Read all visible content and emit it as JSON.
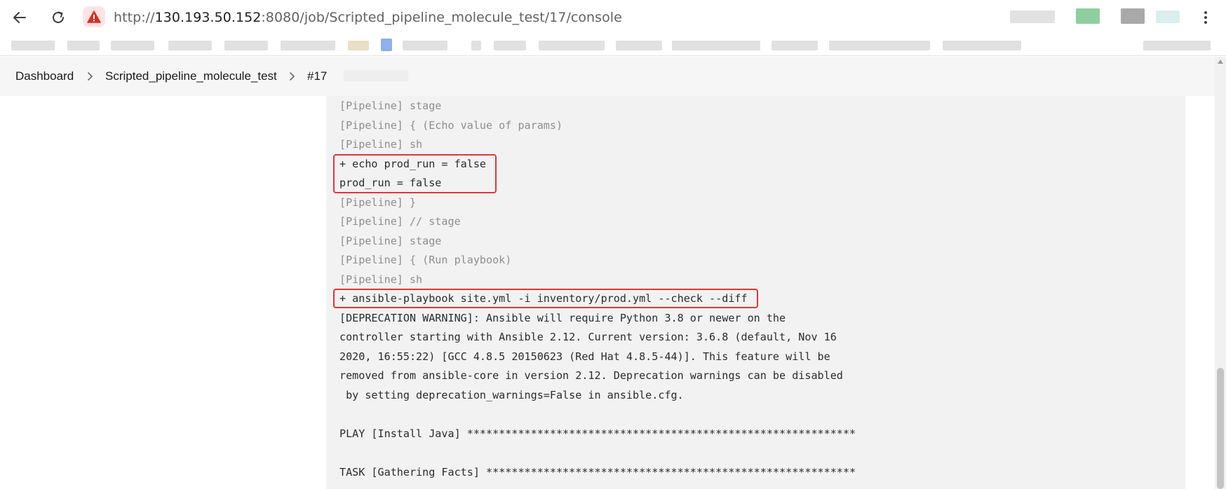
{
  "browser": {
    "back_icon": "arrow-left-icon",
    "reload_icon": "reload-icon",
    "security_icon": "warning-triangle-icon",
    "security_color": "#d93025",
    "url": {
      "prefix": "http://",
      "host": "130.193.50.152",
      "rest": ":8080/job/Scripted_pipeline_molecule_test/17/console"
    },
    "menu_icon": "more-vertical-icon"
  },
  "breadcrumb": {
    "items": [
      {
        "label": "Dashboard"
      },
      {
        "label": "Scripted_pipeline_molecule_test"
      },
      {
        "label": "#17"
      }
    ],
    "separator_icon": "chevron-right-icon"
  },
  "console": {
    "lines": [
      {
        "text": "[Pipeline] stage",
        "dim": true
      },
      {
        "text": "[Pipeline] { (Echo value of params)",
        "dim": true
      },
      {
        "text": "[Pipeline] sh",
        "dim": true
      },
      {
        "text": "+ echo prod_run = false",
        "dim": false,
        "highlight": 1
      },
      {
        "text": "prod_run = false",
        "dim": false,
        "highlight": 1
      },
      {
        "text": "[Pipeline] }",
        "dim": true
      },
      {
        "text": "[Pipeline] // stage",
        "dim": true
      },
      {
        "text": "[Pipeline] stage",
        "dim": true
      },
      {
        "text": "[Pipeline] { (Run playbook)",
        "dim": true
      },
      {
        "text": "[Pipeline] sh",
        "dim": true
      },
      {
        "text": "+ ansible-playbook site.yml -i inventory/prod.yml --check --diff",
        "dim": false,
        "highlight": 2
      },
      {
        "text": "[DEPRECATION WARNING]: Ansible will require Python 3.8 or newer on the",
        "dim": false
      },
      {
        "text": "controller starting with Ansible 2.12. Current version: 3.6.8 (default, Nov 16",
        "dim": false
      },
      {
        "text": "2020, 16:55:22) [GCC 4.8.5 20150623 (Red Hat 4.8.5-44)]. This feature will be",
        "dim": false
      },
      {
        "text": "removed from ansible-core in version 2.12. Deprecation warnings can be disabled",
        "dim": false
      },
      {
        "text": " by setting deprecation_warnings=False in ansible.cfg.",
        "dim": false
      },
      {
        "text": "",
        "dim": false
      },
      {
        "text": "PLAY [Install Java] *************************************************************",
        "dim": false
      },
      {
        "text": "",
        "dim": false
      },
      {
        "text": "TASK [Gathering Facts] **********************************************************",
        "dim": false
      }
    ],
    "highlight_color": "#d93a35"
  }
}
